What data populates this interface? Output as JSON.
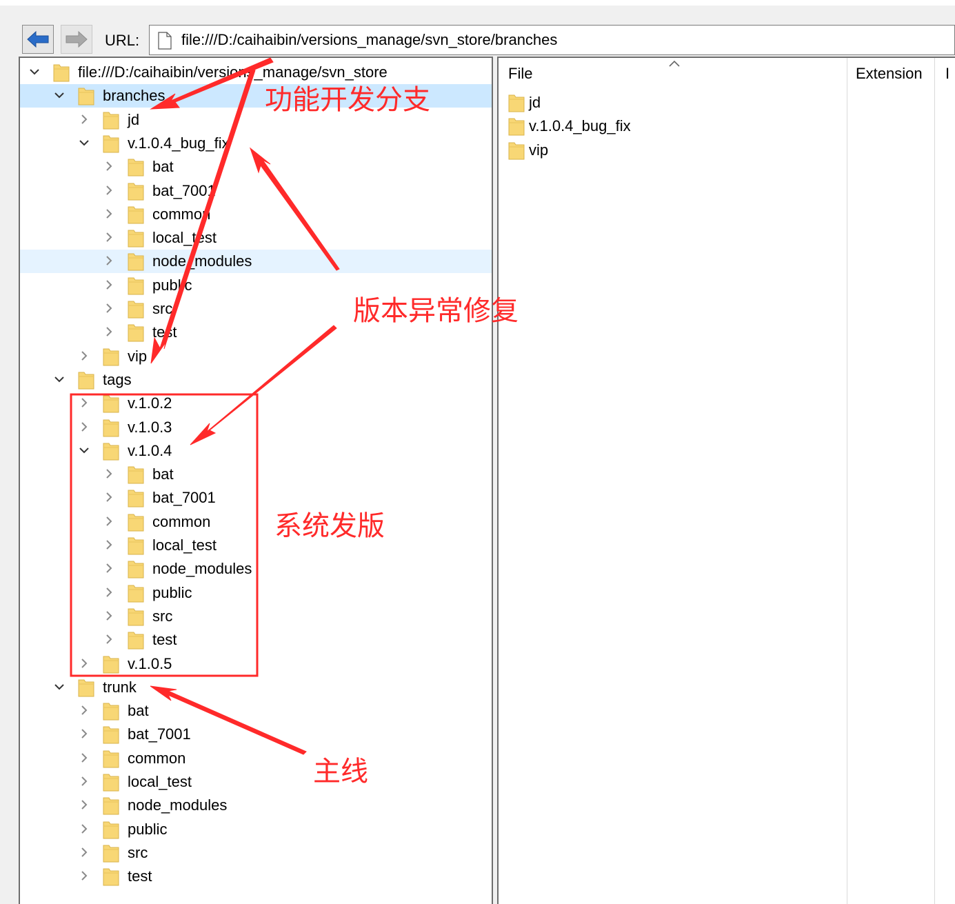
{
  "toolbar": {
    "url_label": "URL:",
    "url_value": "file:///D:/caihaibin/versions_manage/svn_store/branches"
  },
  "tree": {
    "rows": [
      {
        "label": "file:///D:/caihaibin/versions_manage/svn_store",
        "level": 0,
        "expanded": true
      },
      {
        "label": "branches",
        "level": 1,
        "expanded": true,
        "selected": true
      },
      {
        "label": "jd",
        "level": 2,
        "expanded": false
      },
      {
        "label": "v.1.0.4_bug_fix",
        "level": 2,
        "expanded": true
      },
      {
        "label": "bat",
        "level": 3,
        "expanded": false
      },
      {
        "label": "bat_7001",
        "level": 3,
        "expanded": false
      },
      {
        "label": "common",
        "level": 3,
        "expanded": false
      },
      {
        "label": "local_test",
        "level": 3,
        "expanded": false
      },
      {
        "label": "node_modules",
        "level": 3,
        "expanded": false,
        "hover": true
      },
      {
        "label": "public",
        "level": 3,
        "expanded": false
      },
      {
        "label": "src",
        "level": 3,
        "expanded": false
      },
      {
        "label": "test",
        "level": 3,
        "expanded": false
      },
      {
        "label": "vip",
        "level": 2,
        "expanded": false
      },
      {
        "label": "tags",
        "level": 1,
        "expanded": true
      },
      {
        "label": "v.1.0.2",
        "level": 2,
        "expanded": false
      },
      {
        "label": "v.1.0.3",
        "level": 2,
        "expanded": false
      },
      {
        "label": "v.1.0.4",
        "level": 2,
        "expanded": true
      },
      {
        "label": "bat",
        "level": 3,
        "expanded": false
      },
      {
        "label": "bat_7001",
        "level": 3,
        "expanded": false
      },
      {
        "label": "common",
        "level": 3,
        "expanded": false
      },
      {
        "label": "local_test",
        "level": 3,
        "expanded": false
      },
      {
        "label": "node_modules",
        "level": 3,
        "expanded": false
      },
      {
        "label": "public",
        "level": 3,
        "expanded": false
      },
      {
        "label": "src",
        "level": 3,
        "expanded": false
      },
      {
        "label": "test",
        "level": 3,
        "expanded": false
      },
      {
        "label": "v.1.0.5",
        "level": 2,
        "expanded": false
      },
      {
        "label": "trunk",
        "level": 1,
        "expanded": true
      },
      {
        "label": "bat",
        "level": 2,
        "expanded": false
      },
      {
        "label": "bat_7001",
        "level": 2,
        "expanded": false
      },
      {
        "label": "common",
        "level": 2,
        "expanded": false
      },
      {
        "label": "local_test",
        "level": 2,
        "expanded": false
      },
      {
        "label": "node_modules",
        "level": 2,
        "expanded": false
      },
      {
        "label": "public",
        "level": 2,
        "expanded": false
      },
      {
        "label": "src",
        "level": 2,
        "expanded": false
      },
      {
        "label": "test",
        "level": 2,
        "expanded": false
      }
    ]
  },
  "file_list": {
    "columns": [
      "File",
      "Extension",
      "I"
    ],
    "items": [
      "jd",
      "v.1.0.4_bug_fix",
      "vip"
    ]
  },
  "annotations": {
    "feature_branch": "功能开发分支",
    "bug_fix": "版本异常修复",
    "release": "系统发版",
    "mainline": "主线"
  },
  "colors": {
    "annotation": "#ff2a2a",
    "selection": "#cce8ff",
    "hover": "#e5f3ff",
    "folder": "#f8d775",
    "nav_arrow": "#2a6cc8"
  }
}
